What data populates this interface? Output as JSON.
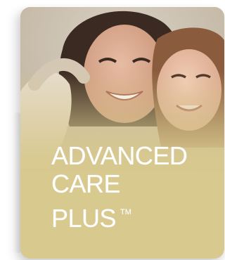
{
  "banner": {
    "line1": "ADVANCED",
    "line2": "CARE",
    "line3": "PLUS",
    "trademark": "TM"
  },
  "colors": {
    "card_background": "#d8c98f",
    "text": "#ffffff"
  },
  "photo": {
    "icon": "mother-and-daughter-photo"
  }
}
